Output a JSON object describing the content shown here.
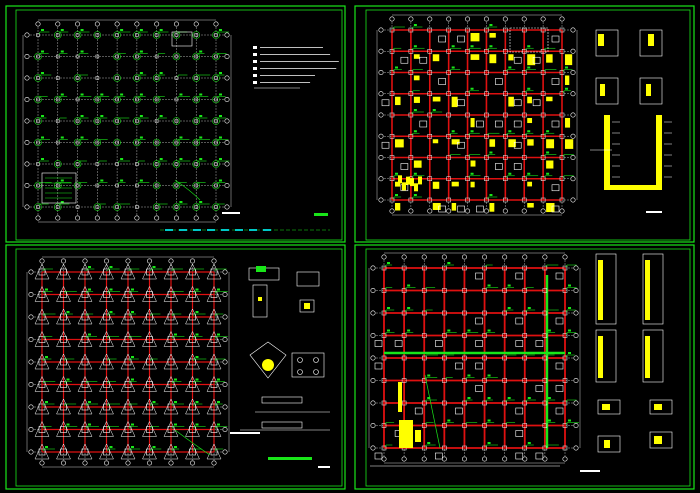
{
  "viewer": {
    "background": "#000000",
    "border_color": "#19e619",
    "colors": {
      "grid_line": "#d9d9d9",
      "column": "#19e619",
      "beam": "#e01010",
      "yellow": "#ffff00",
      "cyan": "#00c8c8",
      "white": "#ffffff",
      "green": "#19e619"
    }
  },
  "sheets": [
    {
      "name": "sheet-top-left",
      "description_lines": 6,
      "style": "column-plan",
      "grid_cols": 10,
      "grid_rows": 9
    },
    {
      "name": "sheet-top-right",
      "style": "beam-plan",
      "grid_cols": 10,
      "grid_rows": 9
    },
    {
      "name": "sheet-bottom-left",
      "style": "foundation-plan",
      "grid_cols": 9,
      "grid_rows": 9
    },
    {
      "name": "sheet-bottom-right",
      "style": "beam-plan-2",
      "grid_cols": 10,
      "grid_rows": 9
    }
  ]
}
